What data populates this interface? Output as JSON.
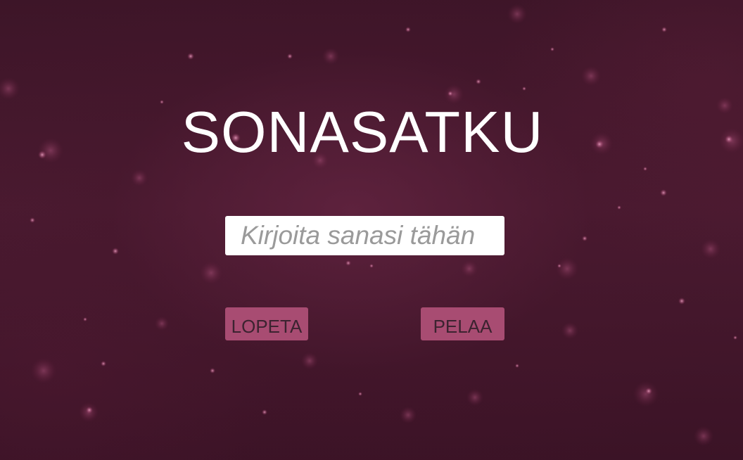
{
  "screen": {
    "title": "SONASATKU",
    "background_color": "#3a1426",
    "accent_color": "#a84c72"
  },
  "word_input": {
    "value": "",
    "placeholder": "Kirjoita sanasi tähän"
  },
  "buttons": {
    "quit_label": "LOPETA",
    "play_label": "PELAA"
  }
}
